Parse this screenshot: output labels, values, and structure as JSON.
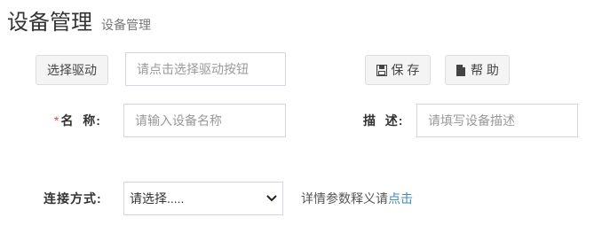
{
  "header": {
    "title": "设备管理",
    "subtitle": "设备管理"
  },
  "toolbar": {
    "select_driver_label": "选择驱动",
    "driver_placeholder": "请点击选择驱动按钮",
    "save_label": "保 存",
    "help_label": "帮 助",
    "save_icon": "save-icon",
    "help_icon": "file-icon"
  },
  "form": {
    "required_mark": "*",
    "name_label": "名  称:",
    "name_placeholder": "请输入设备名称",
    "desc_label": "描  述:",
    "desc_placeholder": "请填写设备描述",
    "connection_label": "连接方式:",
    "connection_selected": "请选择.....",
    "detail_hint": "详情参数释义请",
    "detail_link": "点击"
  },
  "colors": {
    "required": "#dd4b39",
    "link": "#3c8dbc",
    "button_bg": "#f4f4f4",
    "input_border": "#d2d6de"
  }
}
